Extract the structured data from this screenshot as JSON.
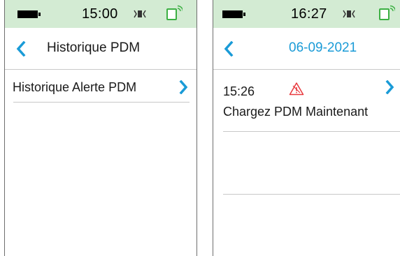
{
  "left_screen": {
    "status": {
      "time": "15:00"
    },
    "nav": {
      "title": "Historique PDM"
    },
    "items": [
      {
        "label": "Historique Alerte PDM"
      }
    ]
  },
  "right_screen": {
    "status": {
      "time": "16:27"
    },
    "nav": {
      "title": "06-09-2021"
    },
    "items": [
      {
        "time": "15:26",
        "message": "Chargez PDM Maintenant"
      }
    ]
  },
  "colors": {
    "status_bar_bg": "#d3ebd3",
    "accent_blue": "#1a9bd7",
    "alert_red": "#e8383d",
    "signal_green": "#3cb043"
  },
  "icons": {
    "battery": "battery-full-icon",
    "vibrate": "vibrate-icon",
    "signal": "signal-icon",
    "back": "chevron-left-icon",
    "forward": "chevron-right-icon",
    "alert": "warning-triangle-icon"
  }
}
